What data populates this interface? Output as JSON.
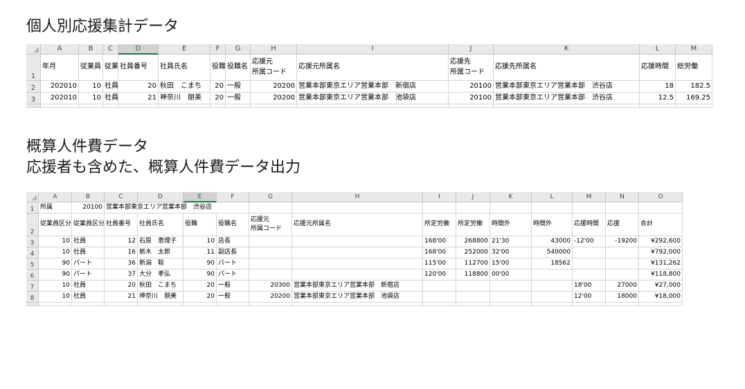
{
  "titles": {
    "t1": "個人別応援集計データ",
    "t2a": "概算人件費データ",
    "t2b": "応援者も含めた、概算人件費データ出力"
  },
  "sheet1": {
    "columns": [
      "A",
      "B",
      "C",
      "D",
      "E",
      "F",
      "G",
      "H",
      "I",
      "J",
      "K",
      "L",
      "M"
    ],
    "selected_column": "D",
    "row_numbers": [
      "1",
      "2",
      "3"
    ],
    "headers": [
      "年月",
      "従業員",
      "従業",
      "社員番号",
      "社員氏名",
      "役職",
      "役職名",
      "応援元\n所属コード",
      "応援元所属名",
      "応援先\n所属コード",
      "応援先所属名",
      "応援時間",
      "総労働"
    ],
    "rows": [
      [
        "202010",
        "10",
        "社員",
        "20",
        "秋田　こまち",
        "20",
        "一般",
        "20200",
        "営業本部東京エリア営業本部　新宿店",
        "20100",
        "営業本部東京エリア営業本部　渋谷店",
        "18",
        "182.5"
      ],
      [
        "202010",
        "10",
        "社員",
        "21",
        "神奈川　朋美",
        "20",
        "一般",
        "20200",
        "営業本部東京エリア営業本部　池袋店",
        "20100",
        "営業本部東京エリア営業本部　渋谷店",
        "12.5",
        "169.25"
      ]
    ]
  },
  "sheet2": {
    "columns": [
      "A",
      "B",
      "C",
      "D",
      "E",
      "F",
      "G",
      "H",
      "I",
      "J",
      "K",
      "L",
      "M",
      "N",
      "O"
    ],
    "selected_column": "E",
    "row_numbers": [
      "1",
      "2",
      "3",
      "4",
      "5",
      "6",
      "7",
      "8"
    ],
    "row1": [
      "所属",
      "20100",
      "営業本部東京エリア営業本部　渋谷店"
    ],
    "headers": [
      "従業員区分",
      "従業員区分",
      "社員番号",
      "社員氏名",
      "役職",
      "役職名",
      "応援元\n所属コード",
      "応援元所属名",
      "所定労働",
      "所定労働",
      "時間外",
      "時間外",
      "応援時間",
      "応援",
      "合計"
    ],
    "rows": [
      [
        "10",
        "社員",
        "12",
        "石原　恵理子",
        "10",
        "店長",
        "",
        "",
        "168'00",
        "268800",
        "21'30",
        "43000",
        "-12'00",
        "-19200",
        "¥292,600"
      ],
      [
        "10",
        "社員",
        "16",
        "栃木　太郎",
        "11",
        "副店長",
        "",
        "",
        "168'00",
        "252000",
        "32'00",
        "540000",
        "",
        "",
        "¥792,000"
      ],
      [
        "90",
        "パート",
        "36",
        "新潟　聡",
        "90",
        "パート",
        "",
        "",
        "115'00",
        "112700",
        "15'00",
        "18562",
        "",
        "",
        "¥131,262"
      ],
      [
        "90",
        "パート",
        "37",
        "大分　孝弘",
        "90",
        "パート",
        "",
        "",
        "120'00",
        "118800",
        "00'00",
        "",
        "",
        "",
        "¥118,800"
      ],
      [
        "10",
        "社員",
        "20",
        "秋田　こまち",
        "20",
        "一般",
        "20300",
        "営業本部東京エリア営業本部　新宿店",
        "",
        "",
        "",
        "",
        "18'00",
        "27000",
        "¥27,000"
      ],
      [
        "10",
        "社員",
        "21",
        "神奈川　朋美",
        "20",
        "一般",
        "20200",
        "営業本部東京エリア営業本部　池袋店",
        "",
        "",
        "",
        "",
        "12'00",
        "18000",
        "¥18,000"
      ]
    ]
  }
}
